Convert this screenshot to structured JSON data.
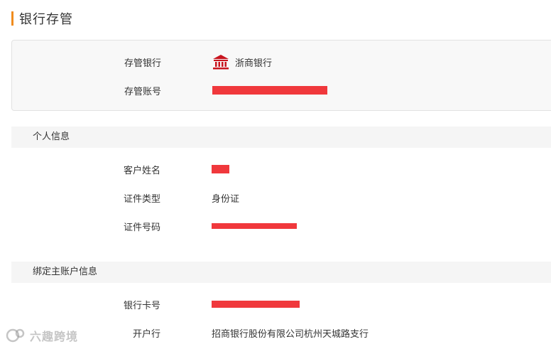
{
  "page": {
    "title": "银行存管"
  },
  "custody": {
    "bank_label": "存管银行",
    "bank_value": "浙商银行",
    "bank_icon": "bank-icon",
    "account_label": "存管账号"
  },
  "personal": {
    "section_title": "个人信息",
    "name_label": "客户姓名",
    "id_type_label": "证件类型",
    "id_type_value": "身份证",
    "id_number_label": "证件号码"
  },
  "linked": {
    "section_title": "绑定主账户信息",
    "card_label": "银行卡号",
    "branch_label": "开户行",
    "branch_value": "招商银行股份有限公司杭州天城路支行"
  },
  "watermark": {
    "text": "六趣跨境"
  },
  "colors": {
    "accent": "#f08c1e",
    "redact": "#f0383c",
    "bank_icon": "#c8141e"
  }
}
